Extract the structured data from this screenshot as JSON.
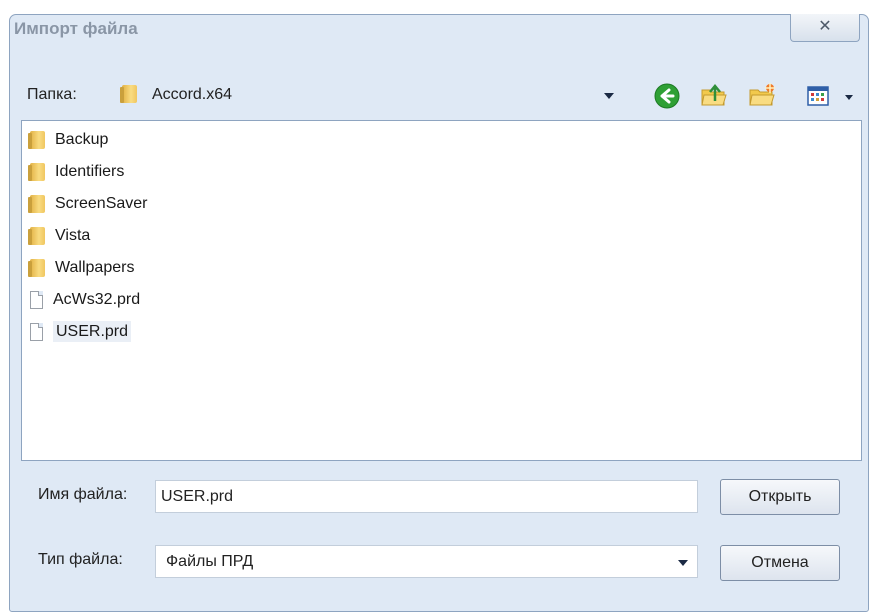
{
  "dialog": {
    "title": "Импорт файла",
    "close_symbol": "☒"
  },
  "toolbar": {
    "folder_label": "Папка:",
    "folder_value": "Accord.x64",
    "buttons": [
      "back-icon",
      "up-folder-icon",
      "new-folder-icon",
      "view-menu-icon"
    ]
  },
  "files": [
    {
      "name": "Backup",
      "type": "folder"
    },
    {
      "name": "Identifiers",
      "type": "folder"
    },
    {
      "name": "ScreenSaver",
      "type": "folder"
    },
    {
      "name": "Vista",
      "type": "folder"
    },
    {
      "name": "Wallpapers",
      "type": "folder"
    },
    {
      "name": "AcWs32.prd",
      "type": "file"
    },
    {
      "name": "USER.prd",
      "type": "file",
      "selected": true
    }
  ],
  "filename": {
    "label": "Имя файла:",
    "value": "USER.prd"
  },
  "filetype": {
    "label": "Тип файла:",
    "value": "Файлы ПРД"
  },
  "buttons": {
    "open": "Открыть",
    "cancel": "Отмена"
  },
  "colors": {
    "window_bg": "#dfe9f5",
    "accent_green": "#2fa035",
    "folder_yellow": "#f2c94c"
  }
}
